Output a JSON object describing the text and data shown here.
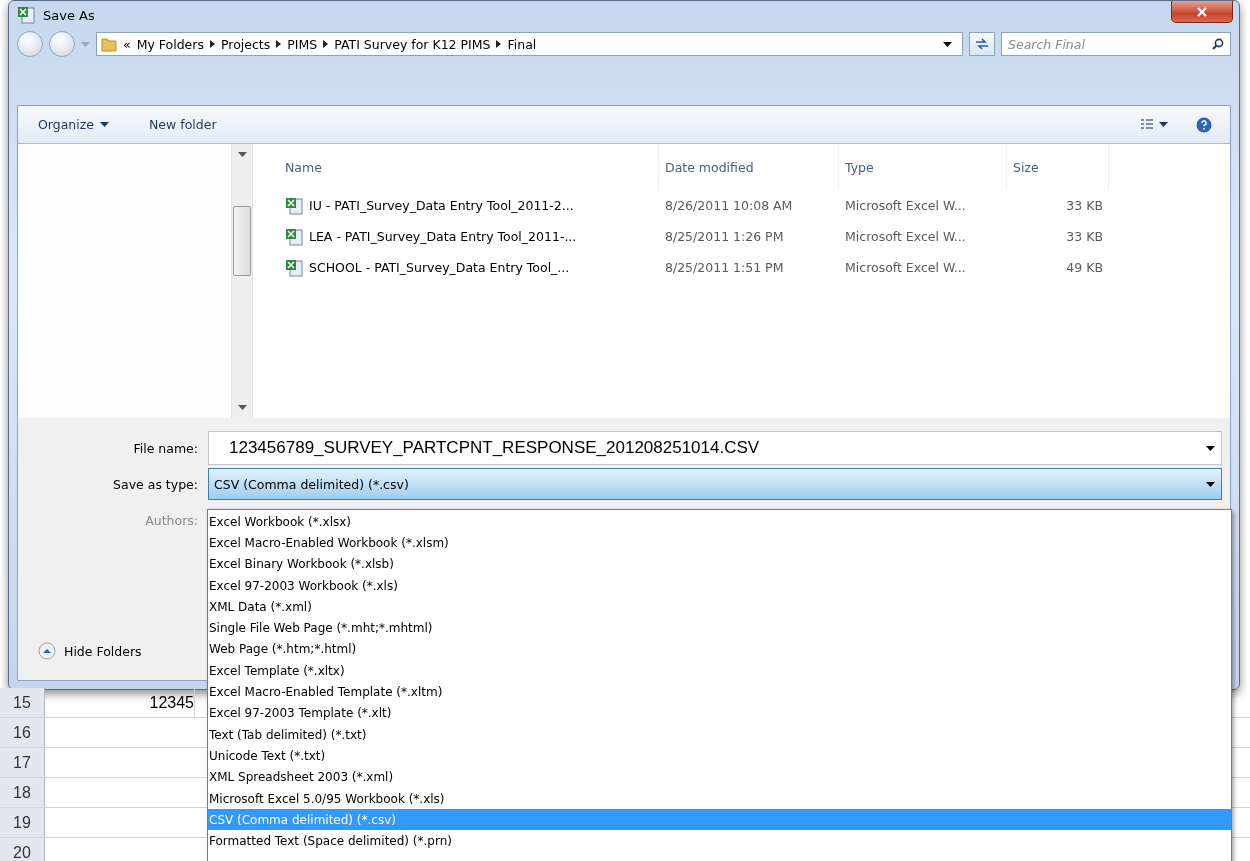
{
  "window": {
    "title": "Save As"
  },
  "address": {
    "overflow": "«",
    "path": [
      "My Folders",
      "Projects",
      "PIMS",
      "PATI Survey for K12 PIMS",
      "Final"
    ]
  },
  "search": {
    "placeholder": "Search Final"
  },
  "toolbar": {
    "organize": "Organize",
    "new_folder": "New folder"
  },
  "table": {
    "columns": [
      "Name",
      "Date modified",
      "Type",
      "Size"
    ],
    "rows": [
      {
        "name": "IU - PATI_Survey_Data Entry Tool_2011-2...",
        "date": "8/26/2011 10:08 AM",
        "type": "Microsoft Excel W...",
        "size": "33 KB"
      },
      {
        "name": "LEA - PATI_Survey_Data Entry Tool_2011-...",
        "date": "8/25/2011 1:26 PM",
        "type": "Microsoft Excel W...",
        "size": "33 KB"
      },
      {
        "name": "SCHOOL - PATI_Survey_Data Entry Tool_...",
        "date": "8/25/2011 1:51 PM",
        "type": "Microsoft Excel W...",
        "size": "49 KB"
      }
    ]
  },
  "file_name": {
    "label": "File name:",
    "value": "123456789_SURVEY_PARTCPNT_RESPONSE_201208251014.CSV"
  },
  "save_type": {
    "label": "Save as type:",
    "value": "CSV (Comma delimited) (*.csv)",
    "expanded": true,
    "options": [
      {
        "label": "Excel Workbook (*.xlsx)",
        "selected": false
      },
      {
        "label": "Excel Macro-Enabled Workbook (*.xlsm)",
        "selected": false
      },
      {
        "label": "Excel Binary Workbook (*.xlsb)",
        "selected": false
      },
      {
        "label": "Excel 97-2003 Workbook (*.xls)",
        "selected": false
      },
      {
        "label": "XML Data (*.xml)",
        "selected": false
      },
      {
        "label": "Single File Web Page (*.mht;*.mhtml)",
        "selected": false
      },
      {
        "label": "Web Page (*.htm;*.html)",
        "selected": false
      },
      {
        "label": "Excel Template (*.xltx)",
        "selected": false
      },
      {
        "label": "Excel Macro-Enabled Template (*.xltm)",
        "selected": false
      },
      {
        "label": "Excel 97-2003 Template (*.xlt)",
        "selected": false
      },
      {
        "label": "Text (Tab delimited) (*.txt)",
        "selected": false
      },
      {
        "label": "Unicode Text (*.txt)",
        "selected": false
      },
      {
        "label": "XML Spreadsheet 2003 (*.xml)",
        "selected": false
      },
      {
        "label": "Microsoft Excel 5.0/95 Workbook (*.xls)",
        "selected": false
      },
      {
        "label": "CSV (Comma delimited) (*.csv)",
        "selected": true
      },
      {
        "label": "Formatted Text (Space delimited) (*.prn)",
        "selected": false
      }
    ]
  },
  "authors": {
    "label": "Authors:"
  },
  "hide_folders": "Hide Folders",
  "sheet": {
    "rows": [
      {
        "number": "15",
        "cell": "12345"
      },
      {
        "number": "16"
      },
      {
        "number": "17"
      },
      {
        "number": "18"
      },
      {
        "number": "19"
      },
      {
        "number": "20"
      }
    ]
  }
}
